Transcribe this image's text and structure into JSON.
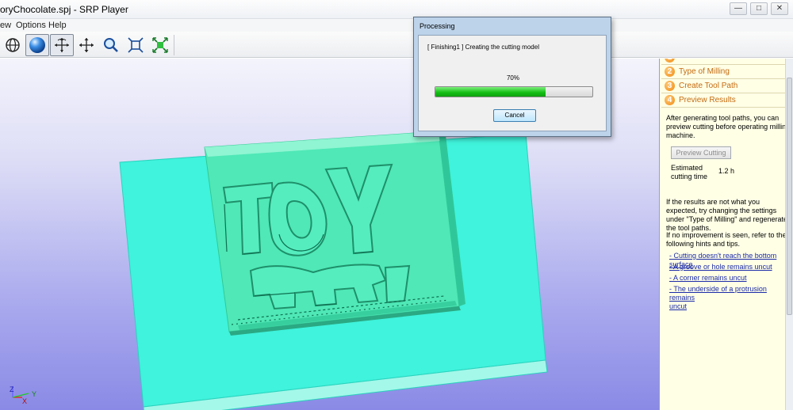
{
  "window": {
    "title": "oryChocolate.spj - SRP Player",
    "controls": [
      "—",
      "□",
      "✕"
    ]
  },
  "menu": [
    "ew",
    "Options",
    "Help"
  ],
  "toolbar": {
    "tools": [
      {
        "name": "globe-view",
        "icon": "globe-icon"
      },
      {
        "name": "shaded-view",
        "icon": "sphere-icon",
        "pressed": true
      },
      {
        "name": "rotate-view",
        "icon": "rotate-icon",
        "pressed": true
      },
      {
        "name": "pan-view",
        "icon": "pan-arrows-icon"
      },
      {
        "name": "zoom",
        "icon": "magnifier-icon"
      },
      {
        "name": "fit-view",
        "icon": "fit-frame-icon"
      },
      {
        "name": "zoom-extents",
        "icon": "expand-arrows-icon"
      }
    ]
  },
  "viewport": {
    "axis_labels": {
      "z": "Z",
      "x": "X",
      "y": "Y"
    }
  },
  "panel": {
    "steps": [
      {
        "num": "1",
        "label": ""
      },
      {
        "num": "2",
        "label": "Type of Milling"
      },
      {
        "num": "3",
        "label": "Create Tool Path"
      },
      {
        "num": "4",
        "label": "Preview Results"
      }
    ],
    "intro_lines": [
      "After generating tool paths, you can",
      "preview cutting before operating milling",
      "machine."
    ],
    "preview_button": "Preview Cutting",
    "estimated_label_lines": [
      "Estimated",
      "cutting time"
    ],
    "estimated_value": "1.2  h",
    "hint_lines": [
      "If the results are not what you",
      "expected, try changing the settings",
      "under \"Type of Milling\" and regenerate",
      "the tool paths."
    ],
    "improve_lines": [
      "If no improvement is seen, refer to the",
      "following hints and tips."
    ],
    "links": [
      [
        "- Cutting doesn't reach the bottom surface"
      ],
      [
        "- A groove or hole remains uncut"
      ],
      [
        "- A corner remains uncut"
      ],
      [
        "- The underside of a protrusion remains",
        "uncut"
      ]
    ]
  },
  "dialog": {
    "title": "Processing",
    "status": "[ Finishing1 ]  Creating the cutting model",
    "percent_label": "70%",
    "progress": 0.7,
    "cancel_label": "Cancel"
  },
  "colors": {
    "accent_orange": "#f08a10",
    "step_text": "#c56a10",
    "link": "#1a2aa8",
    "stock": "#3ff3dc",
    "relief": "#4fe8b6",
    "progress_green": "#16c016"
  }
}
